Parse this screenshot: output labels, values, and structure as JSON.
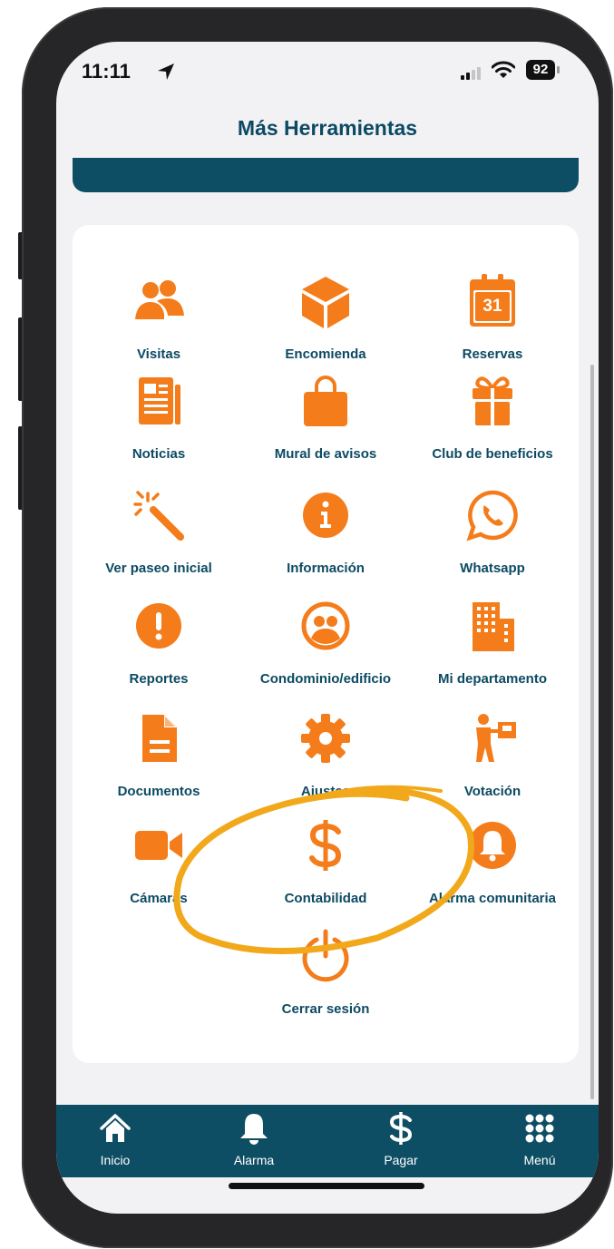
{
  "status_bar": {
    "time": "11:11",
    "battery": "92"
  },
  "header": {
    "title": "Más Herramientas"
  },
  "tools": [
    {
      "label": "Visitas",
      "icon": "users-icon"
    },
    {
      "label": "Encomienda",
      "icon": "box-icon"
    },
    {
      "label": "Reservas",
      "icon": "calendar-icon",
      "icon_text": "31"
    },
    {
      "label": "Noticias",
      "icon": "newspaper-icon"
    },
    {
      "label": "Mural de avisos",
      "icon": "shopping-bag-icon"
    },
    {
      "label": "Club de beneficios",
      "icon": "gift-icon"
    },
    {
      "label": "Ver paseo inicial",
      "icon": "magic-wand-icon"
    },
    {
      "label": "Información",
      "icon": "info-icon"
    },
    {
      "label": "Whatsapp",
      "icon": "whatsapp-icon"
    },
    {
      "label": "Reportes",
      "icon": "exclamation-icon"
    },
    {
      "label": "Condominio/edificio",
      "icon": "community-icon"
    },
    {
      "label": "Mi departamento",
      "icon": "building-icon"
    },
    {
      "label": "Documentos",
      "icon": "document-icon"
    },
    {
      "label": "Ajustes",
      "icon": "gear-icon"
    },
    {
      "label": "Votación",
      "icon": "person-box-icon"
    },
    {
      "label": "Cámaras",
      "icon": "video-camera-icon"
    },
    {
      "label": "Contabilidad",
      "icon": "dollar-icon"
    },
    {
      "label": "Alarma comunitaria",
      "icon": "bell-icon"
    },
    {
      "label": "Cerrar sesión",
      "icon": "power-icon"
    }
  ],
  "tab_bar": [
    {
      "label": "Inicio",
      "icon": "home-icon"
    },
    {
      "label": "Alarma",
      "icon": "bell-icon"
    },
    {
      "label": "Pagar",
      "icon": "dollar-icon"
    },
    {
      "label": "Menú",
      "icon": "grid-icon"
    }
  ],
  "colors": {
    "accent": "#f47c1a",
    "brand": "#0e4e64",
    "highlight_circle": "#f2a81b"
  }
}
